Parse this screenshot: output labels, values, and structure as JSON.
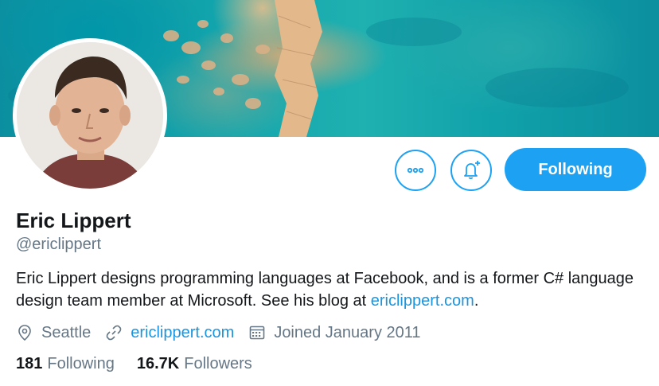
{
  "profile": {
    "name": "Eric Lippert",
    "handle": "@ericlippert",
    "bio": {
      "text": "Eric Lippert designs programming languages at Facebook, and is a former C# language design team member at Microsoft. See his blog at ",
      "link": "ericlippert.com",
      "end": "."
    },
    "location": "Seattle",
    "website": "ericlippert.com",
    "joined": "Joined January 2011"
  },
  "stats": {
    "following_count": "181",
    "following_label": "Following",
    "followers_count": "16.7K",
    "followers_label": "Followers"
  },
  "actions": {
    "more_icon": "more-icon",
    "notify_icon": "bell-plus-icon",
    "follow_label": "Following"
  },
  "colors": {
    "accent": "#1da1f2",
    "link": "#1b95e0",
    "secondary_text": "#657786",
    "primary_text": "#14171a"
  }
}
